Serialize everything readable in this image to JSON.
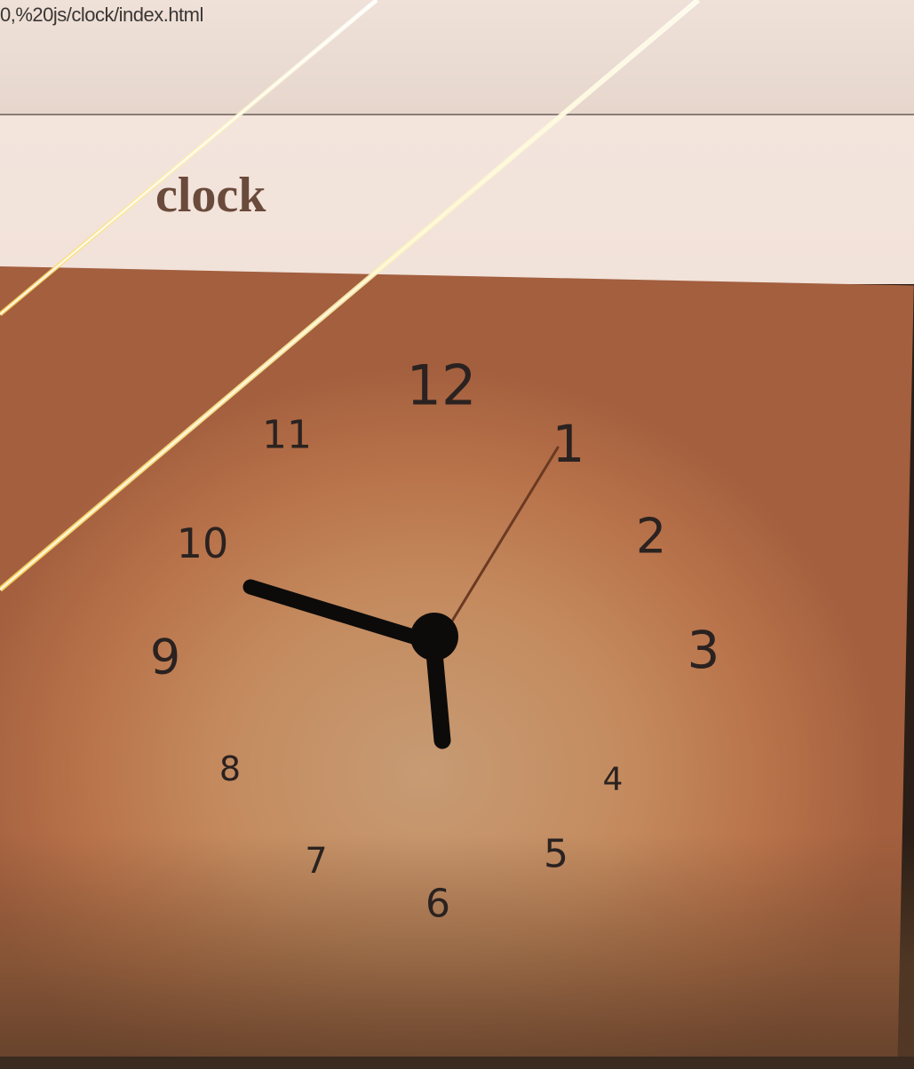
{
  "browser": {
    "url": "0,%20js/clock/index.html"
  },
  "page": {
    "title": "clock"
  },
  "clock": {
    "numerals": [
      "12",
      "1",
      "2",
      "3",
      "4",
      "5",
      "6",
      "7",
      "8",
      "9",
      "10",
      "11"
    ],
    "time_shown": {
      "hour_hand_points_to": "6",
      "minute_hand_points_to": "10",
      "second_hand_points_to": "1"
    },
    "colors": {
      "face": "#c48a5e",
      "hands": "#0d0b0a",
      "second_hand": "#6b3a22",
      "numerals": "#2a2220"
    }
  }
}
